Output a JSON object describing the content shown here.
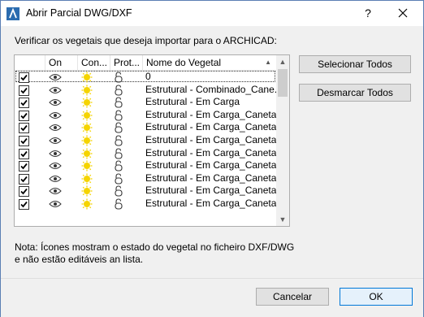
{
  "window": {
    "title": "Abrir Parcial DWG/DXF",
    "help_label": "?",
    "close_label": "✕"
  },
  "instructions": "Verificar os vegetais que deseja importar para o ARCHICAD:",
  "list": {
    "columns": [
      "",
      "On",
      "Con...",
      "Prot...",
      "Nome do Vegetal"
    ],
    "rows": [
      {
        "checked": true,
        "name": "0"
      },
      {
        "checked": true,
        "name": "Estrutural - Combinado_Cane..."
      },
      {
        "checked": true,
        "name": "Estrutural - Em Carga"
      },
      {
        "checked": true,
        "name": "Estrutural - Em Carga_Caneta..."
      },
      {
        "checked": true,
        "name": "Estrutural - Em Carga_Caneta..."
      },
      {
        "checked": true,
        "name": "Estrutural - Em Carga_Caneta..."
      },
      {
        "checked": true,
        "name": "Estrutural - Em Carga_Caneta..."
      },
      {
        "checked": true,
        "name": "Estrutural - Em Carga_Caneta..."
      },
      {
        "checked": true,
        "name": "Estrutural - Em Carga_Caneta..."
      },
      {
        "checked": true,
        "name": "Estrutural - Em Carga_Caneta..."
      },
      {
        "checked": true,
        "name": "Estrutural - Em Carga_Caneta..."
      }
    ],
    "icons": {
      "on": "eye-icon",
      "con": "sun-icon",
      "prot": "unlock-icon"
    }
  },
  "buttons": {
    "select_all": "Selecionar Todos",
    "deselect_all": "Desmarcar Todos",
    "cancel": "Cancelar",
    "ok": "OK"
  },
  "note": "Nota: Ícones mostram o estado do vegetal no ficheiro DXF/DWG e não estão editáveis an lista.",
  "colors": {
    "sun": "#f5d400",
    "ok_border": "#0078d7",
    "app_icon": "#2b6cb0"
  }
}
